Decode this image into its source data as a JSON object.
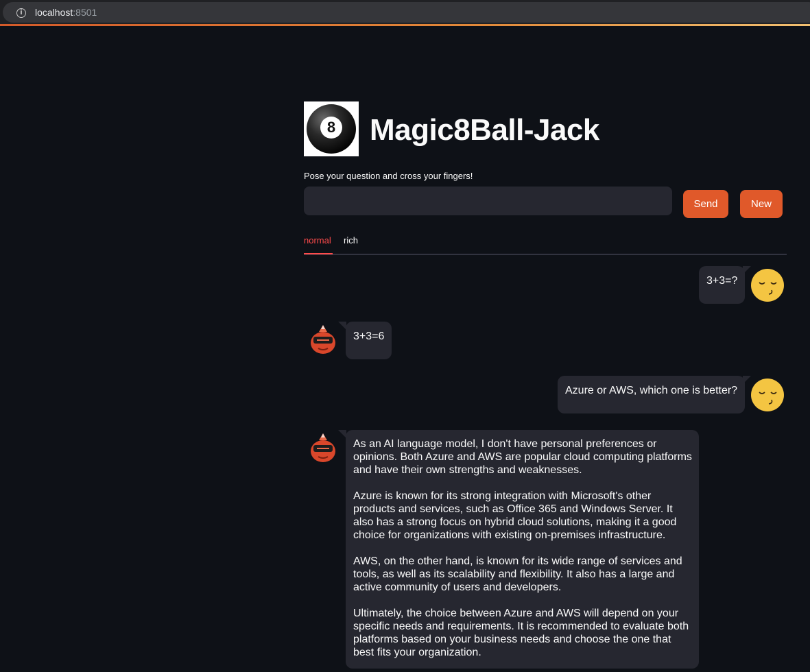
{
  "browser": {
    "url_host": "localhost",
    "url_port": ":8501"
  },
  "header": {
    "logo_glyph": "8",
    "title": "Magic8Ball-Jack"
  },
  "input": {
    "label": "Pose your question and cross your fingers!",
    "value": "",
    "placeholder": ""
  },
  "buttons": {
    "send_label": "Send",
    "new_label": "New"
  },
  "tabs": [
    {
      "label": "normal",
      "active": true
    },
    {
      "label": "rich",
      "active": false
    }
  ],
  "messages": [
    {
      "role": "user",
      "text": [
        "3+3=?"
      ]
    },
    {
      "role": "bot",
      "text": [
        "3+3=6"
      ]
    },
    {
      "role": "user",
      "text": [
        "Azure or AWS, which one is better?"
      ]
    },
    {
      "role": "bot",
      "text": [
        "As an AI language model, I don't have personal preferences or opinions. Both Azure and AWS are popular cloud computing platforms and have their own strengths and weaknesses.",
        "Azure is known for its strong integration with Microsoft's other products and services, such as Office 365 and Windows Server. It also has a strong focus on hybrid cloud solutions, making it a good choice for organizations with existing on-premises infrastructure.",
        "AWS, on the other hand, is known for its wide range of services and tools, as well as its scalability and flexibility. It also has a large and active community of users and developers.",
        "Ultimately, the choice between Azure and AWS will depend on your specific needs and requirements. It is recommended to evaluate both platforms based on your business needs and choose the one that best fits your organization."
      ]
    }
  ],
  "colors": {
    "background": "#0e1117",
    "bubble": "#262730",
    "accent": "#e0592a",
    "active_tab": "#ff4b4b",
    "user_avatar": "#f4c542",
    "bot_avatar": "#d9472b"
  },
  "icons": {
    "user_avatar": "sleepy-smiley-icon",
    "bot_avatar": "robot-icon",
    "site_info": "info-icon"
  }
}
